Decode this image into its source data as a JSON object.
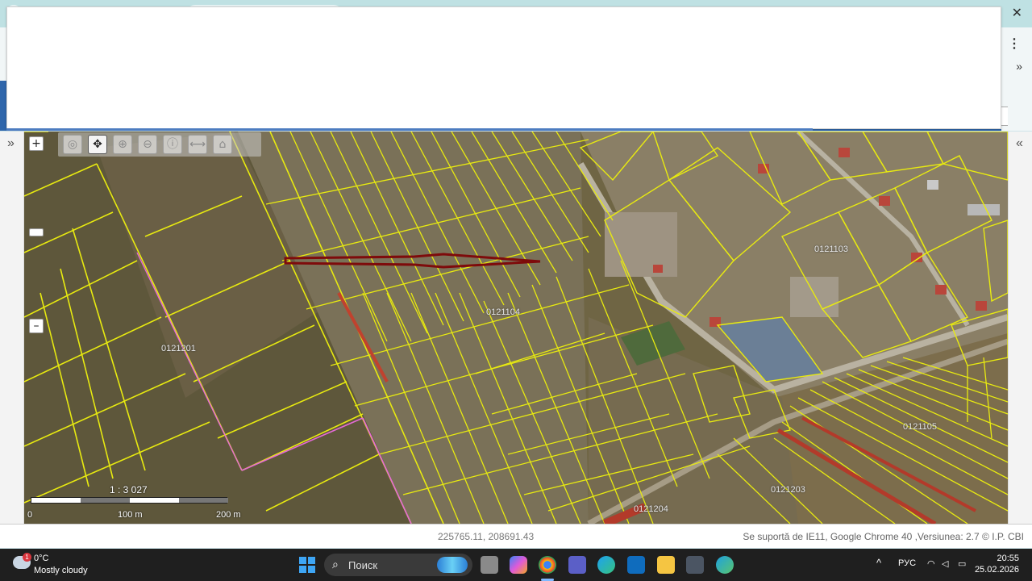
{
  "window": {
    "close_glyph": "✕"
  },
  "browser": {
    "menu_glyph": "⋮",
    "more_glyph": "»"
  },
  "site": {
    "search_edge_text": "ri"
  },
  "side_panels": {
    "left_toggle": "»",
    "right_toggle": "«"
  },
  "map": {
    "zoom_in": "+",
    "zoom_out": "–",
    "tools": [
      {
        "name": "zoom-to-extent-tool",
        "icon": "globe-icon",
        "glyph": "◎",
        "active": false
      },
      {
        "name": "pan-tool",
        "icon": "move-arrows-icon",
        "glyph": "✥",
        "active": true
      },
      {
        "name": "zoom-in-tool",
        "icon": "magnifier-plus-icon",
        "glyph": "⊕",
        "active": false
      },
      {
        "name": "zoom-out-tool",
        "icon": "magnifier-minus-icon",
        "glyph": "⊖",
        "active": false
      },
      {
        "name": "info-tool",
        "icon": "info-icon",
        "glyph": "ⓘ",
        "active": false
      },
      {
        "name": "measure-tool",
        "icon": "ruler-icon",
        "glyph": "⟷",
        "active": false
      },
      {
        "name": "area-tool",
        "icon": "area-icon",
        "glyph": "⌂",
        "active": false
      }
    ],
    "parcel_labels": [
      "0121201",
      "0121104",
      "0121103",
      "0121105",
      "0121203",
      "0121204"
    ],
    "scale": {
      "ratio": "1 : 3 027",
      "labels": [
        "0",
        "100 m",
        "200 m"
      ]
    }
  },
  "status": {
    "coordinates": "225765.11, 208691.43",
    "support": "Se suportă de IE11, Google Chrome 40 ,Versiunea: 2.7 © I.P. CBI"
  },
  "taskbar": {
    "weather_badge": "1",
    "weather_temp": "0°C",
    "weather_desc": "Mostly cloudy",
    "search_placeholder": "Поиск",
    "language": "РУС",
    "time": "20:55",
    "date": "25.02.2026",
    "tray_up": "^"
  }
}
